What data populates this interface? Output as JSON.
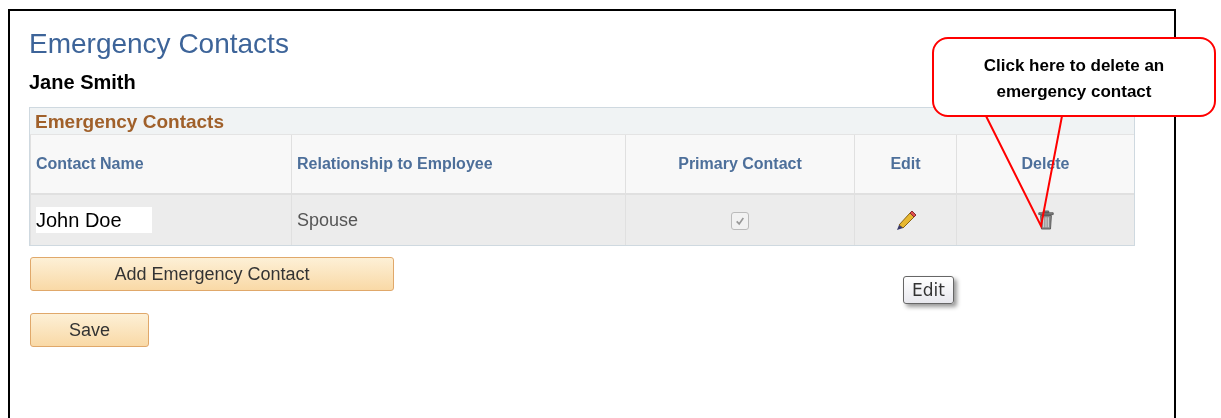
{
  "page": {
    "title": "Emergency Contacts",
    "employee_name": "Jane Smith"
  },
  "grid": {
    "title": "Emergency Contacts",
    "columns": [
      "Contact Name",
      "Relationship to Employee",
      "Primary Contact",
      "Edit",
      "Delete"
    ],
    "rows": [
      {
        "contact_name": "John Doe",
        "relationship": "Spouse",
        "primary_contact": {
          "checked": true,
          "disabled": true
        }
      }
    ]
  },
  "buttons": [
    "Add Emergency Contact",
    "Save"
  ],
  "tooltip": "Edit",
  "callout": "Click here to delete an emergency contact"
}
